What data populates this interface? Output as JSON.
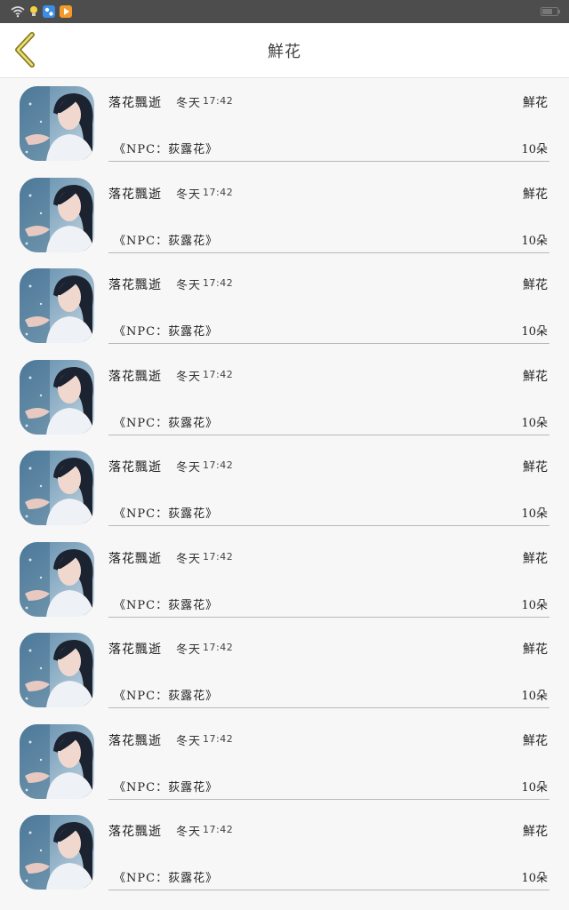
{
  "status_bar": {
    "icons": [
      "wifi-icon",
      "bulb-icon",
      "app-icon-blue",
      "app-icon-orange"
    ],
    "colors": {
      "background": "#4d4d4d",
      "app_blue": "#3a8ee6",
      "app_orange": "#f39a2b",
      "bulb": "#f5d442"
    }
  },
  "header": {
    "title": "鮮花",
    "back_icon": "chevron-left-icon",
    "colors": {
      "back_icon_stroke": "#8a7a1e",
      "back_icon_fill": "#e9e27a"
    }
  },
  "list": {
    "items": [
      {
        "sender": "落花飄逝",
        "tag": "冬天",
        "time": "17:42",
        "type": "鮮花",
        "message": "《NPC：荻露花》",
        "amount": "10朵"
      },
      {
        "sender": "落花飄逝",
        "tag": "冬天",
        "time": "17:42",
        "type": "鮮花",
        "message": "《NPC：荻露花》",
        "amount": "10朵"
      },
      {
        "sender": "落花飄逝",
        "tag": "冬天",
        "time": "17:42",
        "type": "鮮花",
        "message": "《NPC：荻露花》",
        "amount": "10朵"
      },
      {
        "sender": "落花飄逝",
        "tag": "冬天",
        "time": "17:42",
        "type": "鮮花",
        "message": "《NPC：荻露花》",
        "amount": "10朵"
      },
      {
        "sender": "落花飄逝",
        "tag": "冬天",
        "time": "17:42",
        "type": "鮮花",
        "message": "《NPC：荻露花》",
        "amount": "10朵"
      },
      {
        "sender": "落花飄逝",
        "tag": "冬天",
        "time": "17:42",
        "type": "鮮花",
        "message": "《NPC：荻露花》",
        "amount": "10朵"
      },
      {
        "sender": "落花飄逝",
        "tag": "冬天",
        "time": "17:42",
        "type": "鮮花",
        "message": "《NPC：荻露花》",
        "amount": "10朵"
      },
      {
        "sender": "落花飄逝",
        "tag": "冬天",
        "time": "17:42",
        "type": "鮮花",
        "message": "《NPC：荻露花》",
        "amount": "10朵"
      },
      {
        "sender": "落花飄逝",
        "tag": "冬天",
        "time": "17:42",
        "type": "鮮花",
        "message": "《NPC：荻露花》",
        "amount": "10朵"
      }
    ]
  }
}
